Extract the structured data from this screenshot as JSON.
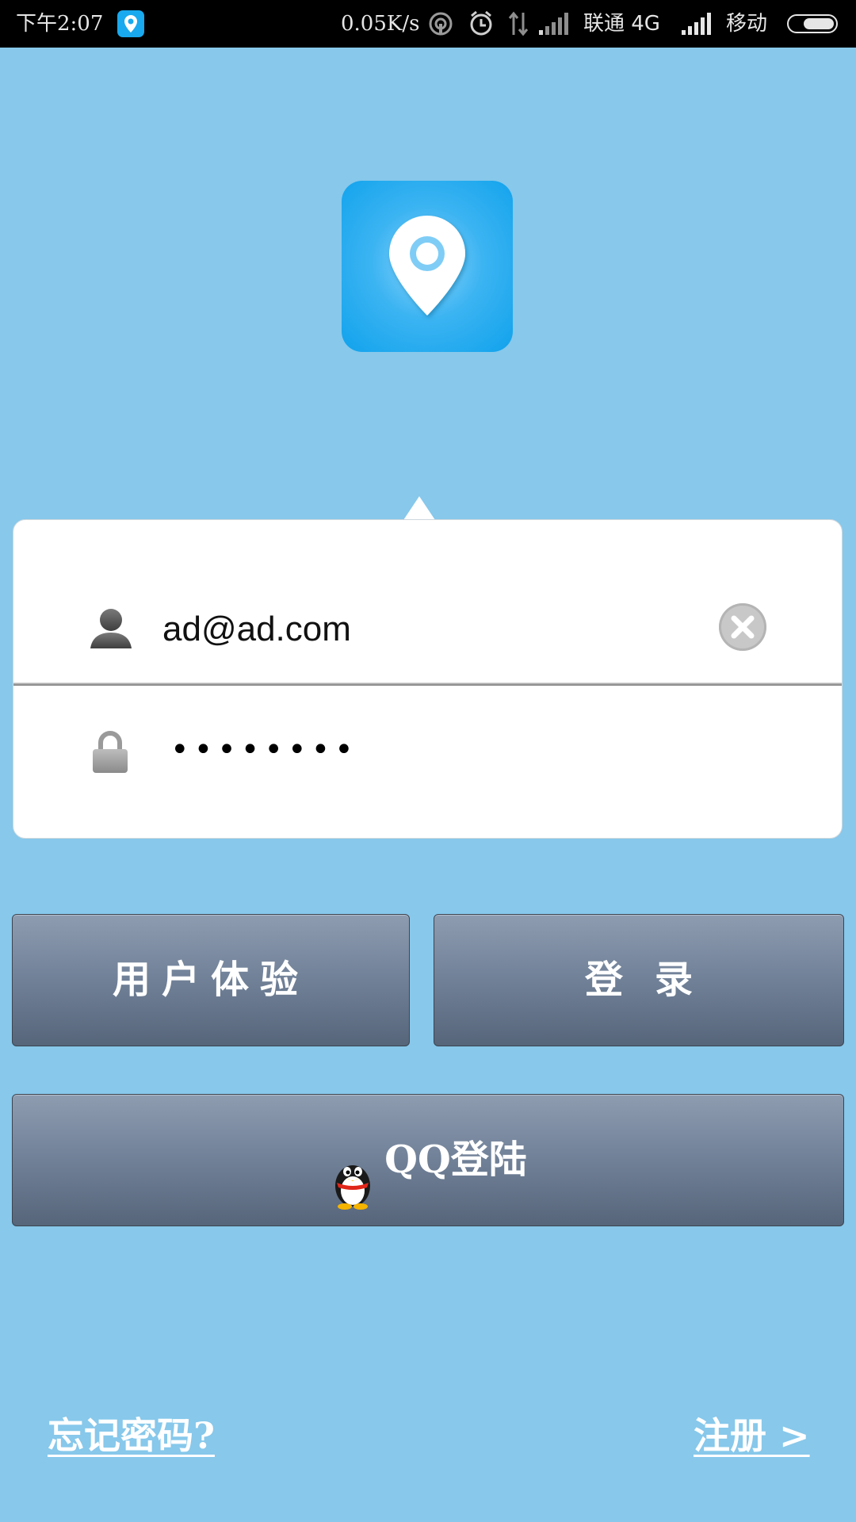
{
  "status_bar": {
    "time": "下午2:07",
    "app_icon": "location-pin-icon",
    "network_speed": "0.05K/s",
    "icons": [
      "hotspot-icon",
      "alarm-icon",
      "data-transfer-icon",
      "signal-icon"
    ],
    "carrier1": "联通 4G",
    "carrier2": "移动",
    "battery_level": 0.7
  },
  "logo": {
    "icon": "location-pin-icon",
    "color": "#19a9ee"
  },
  "login_form": {
    "username_icon": "user-icon",
    "username_value": "ad@ad.com",
    "clear_icon": "clear-icon",
    "password_icon": "lock-icon",
    "password_value": "••••••••"
  },
  "buttons": {
    "experience_label": "用户体验",
    "login_label": "登录",
    "qq_login_label": "QQ登陆",
    "qq_icon": "qq-penguin-icon"
  },
  "links": {
    "forgot_password": "忘记密码?",
    "register": "注册 >"
  },
  "colors": {
    "background": "#87c8eb",
    "button_top": "#8e9cb0",
    "button_bottom": "#56657a"
  }
}
